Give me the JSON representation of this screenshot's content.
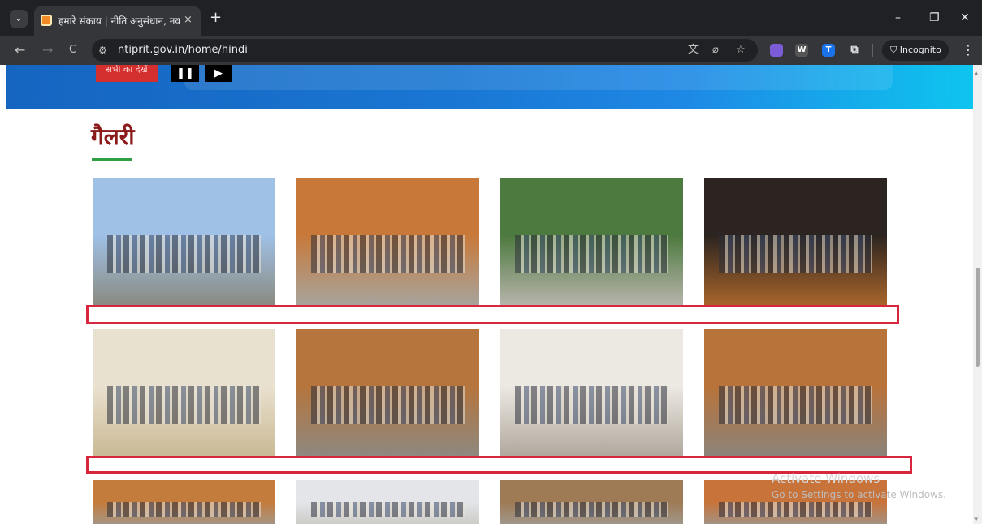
{
  "browser": {
    "tab_title": "हमारे संकाय | नीति अनुसंधान, नवाचा",
    "tab_close_glyph": "×",
    "new_tab_glyph": "+",
    "tab_list_glyph": "⌄",
    "url": "ntiprit.gov.in/home/hindi",
    "back_glyph": "←",
    "forward_glyph": "→",
    "reload_glyph": "C",
    "site_info_glyph": "⚙",
    "translate_glyph": "文",
    "eye_off_glyph": "⌀",
    "bookmark_glyph": "☆",
    "ext_w_label": "W",
    "ext_t_label": "T",
    "extensions_glyph": "⧉",
    "incognito_label": "Incognito",
    "incognito_glyph": "⛉",
    "menu_glyph": "⋮",
    "minimize_glyph": "–",
    "maximize_glyph": "❐",
    "close_glyph": "✕"
  },
  "hero": {
    "red_button_label": "सभी का देखें",
    "pause_glyph": "❚❚",
    "play_glyph": "▶"
  },
  "gallery": {
    "title": "गैलरी",
    "photos": [
      {
        "name": "building",
        "sky": "#9fc1e6",
        "ground": "#8a8a80"
      },
      {
        "name": "welcome-group",
        "sky": "#c8793a",
        "ground": "#a7a49d"
      },
      {
        "name": "courtyard-group",
        "sky": "#4d7a3f",
        "ground": "#b8b5ad"
      },
      {
        "name": "stage-group",
        "sky": "#2c2420",
        "ground": "#a9662b"
      },
      {
        "name": "award-ceremony",
        "sky": "#e9e1cf",
        "ground": "#c9b994"
      },
      {
        "name": "steps-group",
        "sky": "#b5753d",
        "ground": "#8e8880"
      },
      {
        "name": "hall-group",
        "sky": "#ece8e2",
        "ground": "#b0a89d"
      },
      {
        "name": "carpet-group",
        "sky": "#b8733a",
        "ground": "#8b837a"
      },
      {
        "name": "building-2",
        "sky": "#c47c3d",
        "ground": "#9f9a93"
      },
      {
        "name": "indoor-group",
        "sky": "#e3e5e8",
        "ground": "#c8c6c1"
      },
      {
        "name": "courtyard-2",
        "sky": "#9e7a55",
        "ground": "#a29d96"
      },
      {
        "name": "pattern-wall",
        "sky": "#c7733a",
        "ground": "#9d9892"
      }
    ]
  },
  "watermark": {
    "line1": "Activate Windows",
    "line2": "Go to Settings to activate Windows."
  },
  "colors": {
    "highlight": "#d7263d",
    "gallery_title": "#8b1a1a",
    "underline": "#2e9f43"
  }
}
